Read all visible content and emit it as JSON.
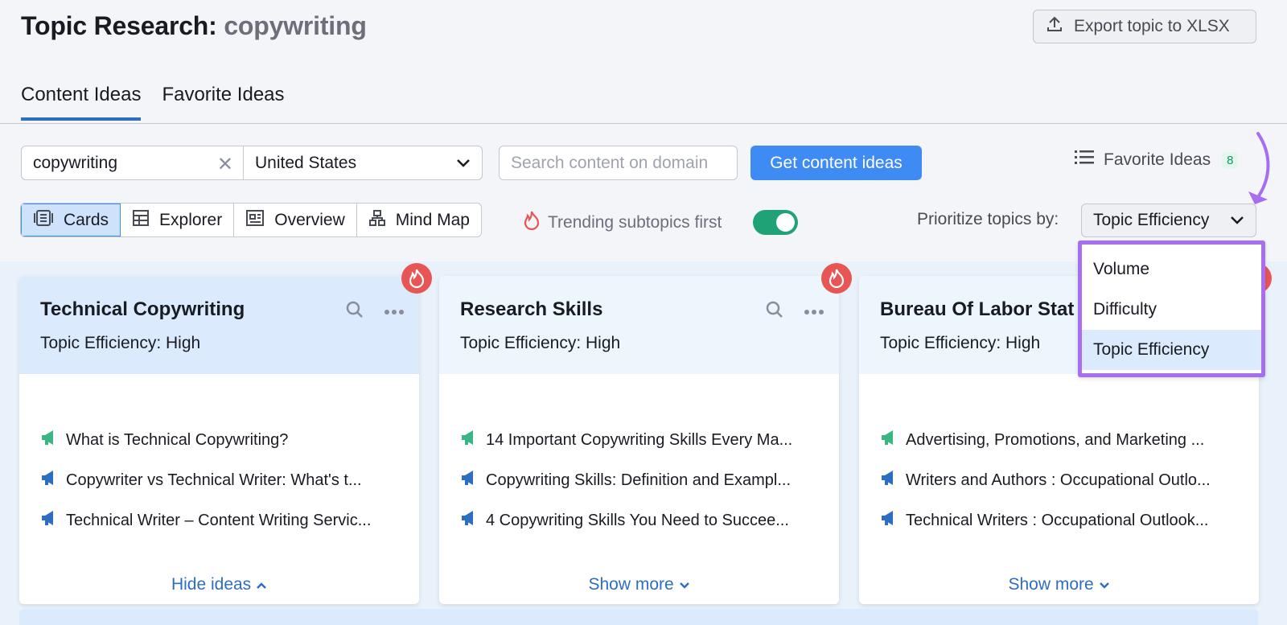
{
  "header": {
    "title_prefix": "Topic Research:",
    "keyword": "copywriting",
    "export_label": "Export topic to XLSX"
  },
  "tabs": [
    {
      "label": "Content Ideas",
      "active": true
    },
    {
      "label": "Favorite Ideas",
      "active": false
    }
  ],
  "search": {
    "keyword_value": "copywriting",
    "country": "United States",
    "domain_placeholder": "Search content on domain",
    "submit_label": "Get content ideas"
  },
  "favorites": {
    "label": "Favorite Ideas",
    "count": "8"
  },
  "views": [
    {
      "label": "Cards",
      "icon": "cards-icon",
      "active": true
    },
    {
      "label": "Explorer",
      "icon": "table-icon",
      "active": false
    },
    {
      "label": "Overview",
      "icon": "overview-icon",
      "active": false
    },
    {
      "label": "Mind Map",
      "icon": "mindmap-icon",
      "active": false
    }
  ],
  "trending": {
    "label": "Trending subtopics first",
    "enabled": true
  },
  "prioritize": {
    "label": "Prioritize topics by:",
    "selected": "Topic Efficiency",
    "options": [
      "Volume",
      "Difficulty",
      "Topic Efficiency"
    ]
  },
  "cards": [
    {
      "title": "Technical Copywriting",
      "efficiency": "Topic Efficiency: High",
      "ideas": [
        "What is Technical Copywriting?",
        "Copywriter vs Technical Writer: What's t...",
        "Technical Writer – Content Writing Servic..."
      ],
      "more_label": "Hide ideas"
    },
    {
      "title": "Research Skills",
      "efficiency": "Topic Efficiency: High",
      "ideas": [
        "14 Important Copywriting Skills Every Ma...",
        "Copywriting Skills: Definition and Exampl...",
        "4 Copywriting Skills You Need to Succee..."
      ],
      "more_label": "Show more"
    },
    {
      "title": "Bureau Of Labor Stat",
      "efficiency": "Topic Efficiency: High",
      "ideas": [
        "Advertising, Promotions, and Marketing ...",
        "Writers and Authors : Occupational Outlo...",
        "Technical Writers : Occupational Outlook..."
      ],
      "more_label": "Show more"
    }
  ],
  "colors": {
    "accent": "#3e8bf3",
    "toggle_on": "#1fa376",
    "highlight": "#a86ef0",
    "fire": "#e85555"
  }
}
